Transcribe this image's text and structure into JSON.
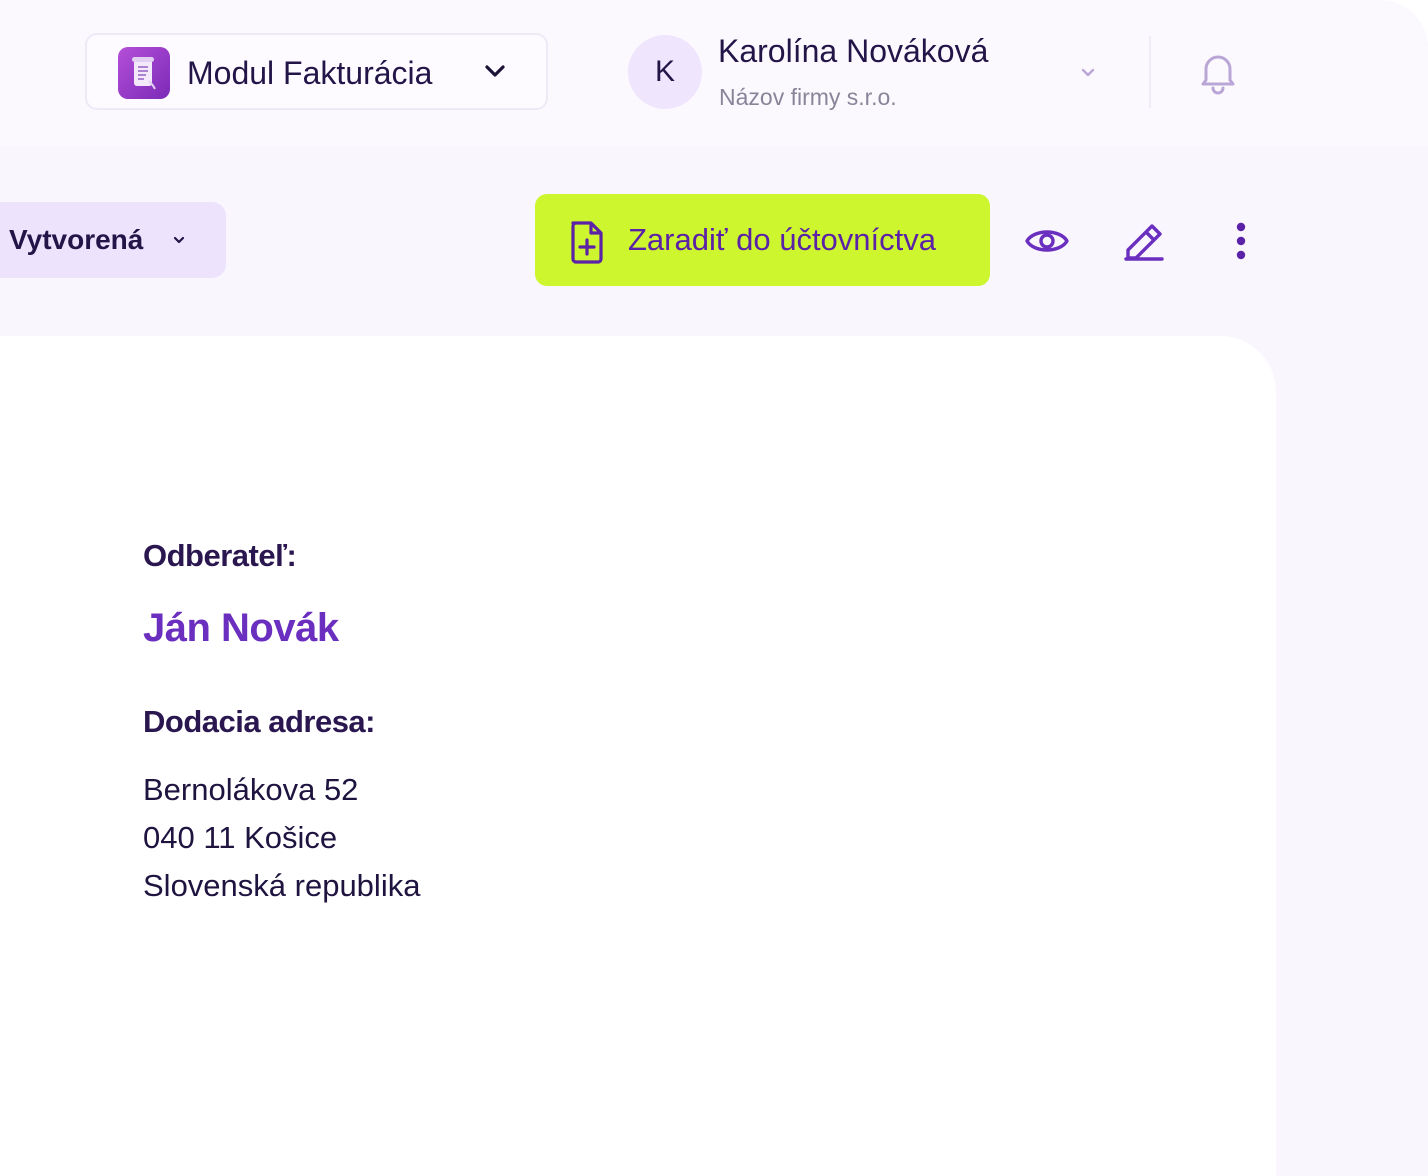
{
  "header": {
    "module": {
      "label": "Modul Fakturácia",
      "icon": "invoice-scroll-icon"
    },
    "user": {
      "initial": "K",
      "name": "Karolína Nováková",
      "company": "Názov firmy s.r.o."
    }
  },
  "toolbar": {
    "status": "Vytvorená",
    "primary_action": "Zaradiť do účtovníctva"
  },
  "document": {
    "customer_label": "Odberateľ:",
    "customer_name": "Ján Novák",
    "delivery_label": "Dodacia adresa:",
    "address": [
      "Bernolákova 52",
      "040 11 Košice",
      "Slovenská republika"
    ]
  },
  "colors": {
    "accent": "#6b2fc0",
    "primary_button": "#cdf62f",
    "text_dark": "#231548",
    "status_pill": "#ede3fd"
  }
}
